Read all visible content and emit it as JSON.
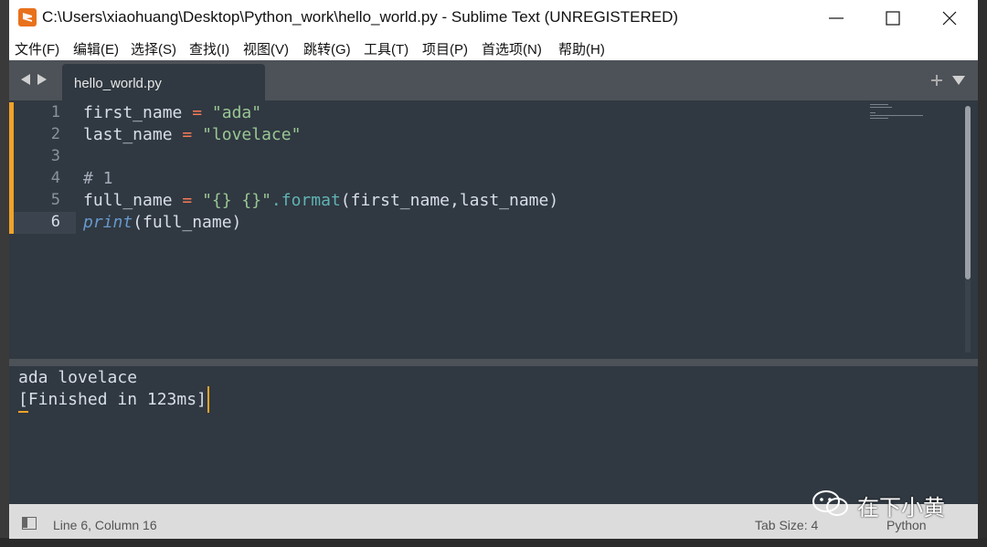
{
  "titlebar": {
    "title": "C:\\Users\\xiaohuang\\Desktop\\Python_work\\hello_world.py - Sublime Text (UNREGISTERED)",
    "minimize_icon": "minimize-icon",
    "maximize_icon": "maximize-icon",
    "close_icon": "close-icon"
  },
  "menu": {
    "items": [
      "文件(F)",
      "编辑(E)",
      "选择(S)",
      "查找(I)",
      "视图(V)",
      "跳转(G)",
      "工具(T)",
      "项目(P)",
      "首选项(N)",
      "帮助(H)"
    ]
  },
  "tabs": {
    "active": "hello_world.py",
    "new_tab_icon": "plus-icon",
    "tab_menu_icon": "chevron-down-icon"
  },
  "editor": {
    "line_numbers": [
      "1",
      "2",
      "3",
      "4",
      "5",
      "6"
    ],
    "active_line": "6",
    "code": {
      "l1_var": "first_name",
      "l1_op": " = ",
      "l1_str": "\"ada\"",
      "l2_var": "last_name",
      "l2_op": " = ",
      "l2_str": "\"lovelace\"",
      "l4_comment": "# 1",
      "l5_var": "full_name",
      "l5_op": " = ",
      "l5_str": "\"{} {}\"",
      "l5_method": ".format",
      "l5_args": "(first_name,last_name)",
      "l6_builtin": "print",
      "l6_args": "(full_name)"
    }
  },
  "output": {
    "line1": "ada lovelace",
    "line2": "[Finished in 123ms]"
  },
  "status": {
    "position": "Line 6, Column 16",
    "tab_size": "Tab Size: 4",
    "syntax": "Python"
  },
  "watermark": {
    "text": "在下小黄"
  },
  "colors": {
    "editor_bg": "#303841",
    "tabbar_bg": "#4d5258",
    "accent_orange": "#f0a22a",
    "string_green": "#99c794",
    "operator_red": "#f97b58",
    "function_teal": "#5fb4b4",
    "builtin_blue": "#6699cc"
  }
}
